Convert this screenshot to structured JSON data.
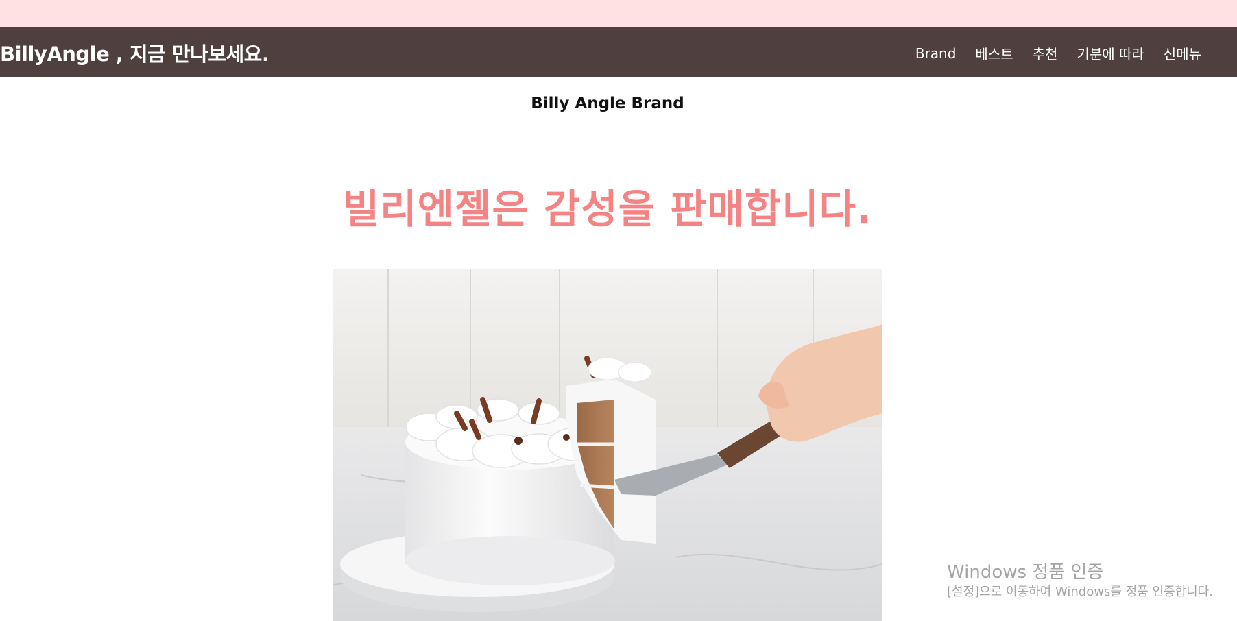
{
  "header": {
    "slogan": "BillyAngle , 지금 만나보세요.",
    "nav": [
      {
        "label": "Brand"
      },
      {
        "label": "베스트"
      },
      {
        "label": "추천"
      },
      {
        "label": "기분에 따라"
      },
      {
        "label": "신메뉴"
      }
    ]
  },
  "main": {
    "section_label": "Billy Angle Brand",
    "headline": "빌리엔젤은 감성을 판매합니다.",
    "hero_image": {
      "depicts": "cake-with-slice-on-server-icon"
    }
  },
  "watermark": {
    "title": "Windows 정품 인증",
    "subtitle": "[설정]으로 이동하여 Windows를 정품 인증합니다."
  },
  "colors": {
    "top_strip": "#ffe1e3",
    "navbar": "#4f3f3f",
    "headline": "#f68384"
  }
}
